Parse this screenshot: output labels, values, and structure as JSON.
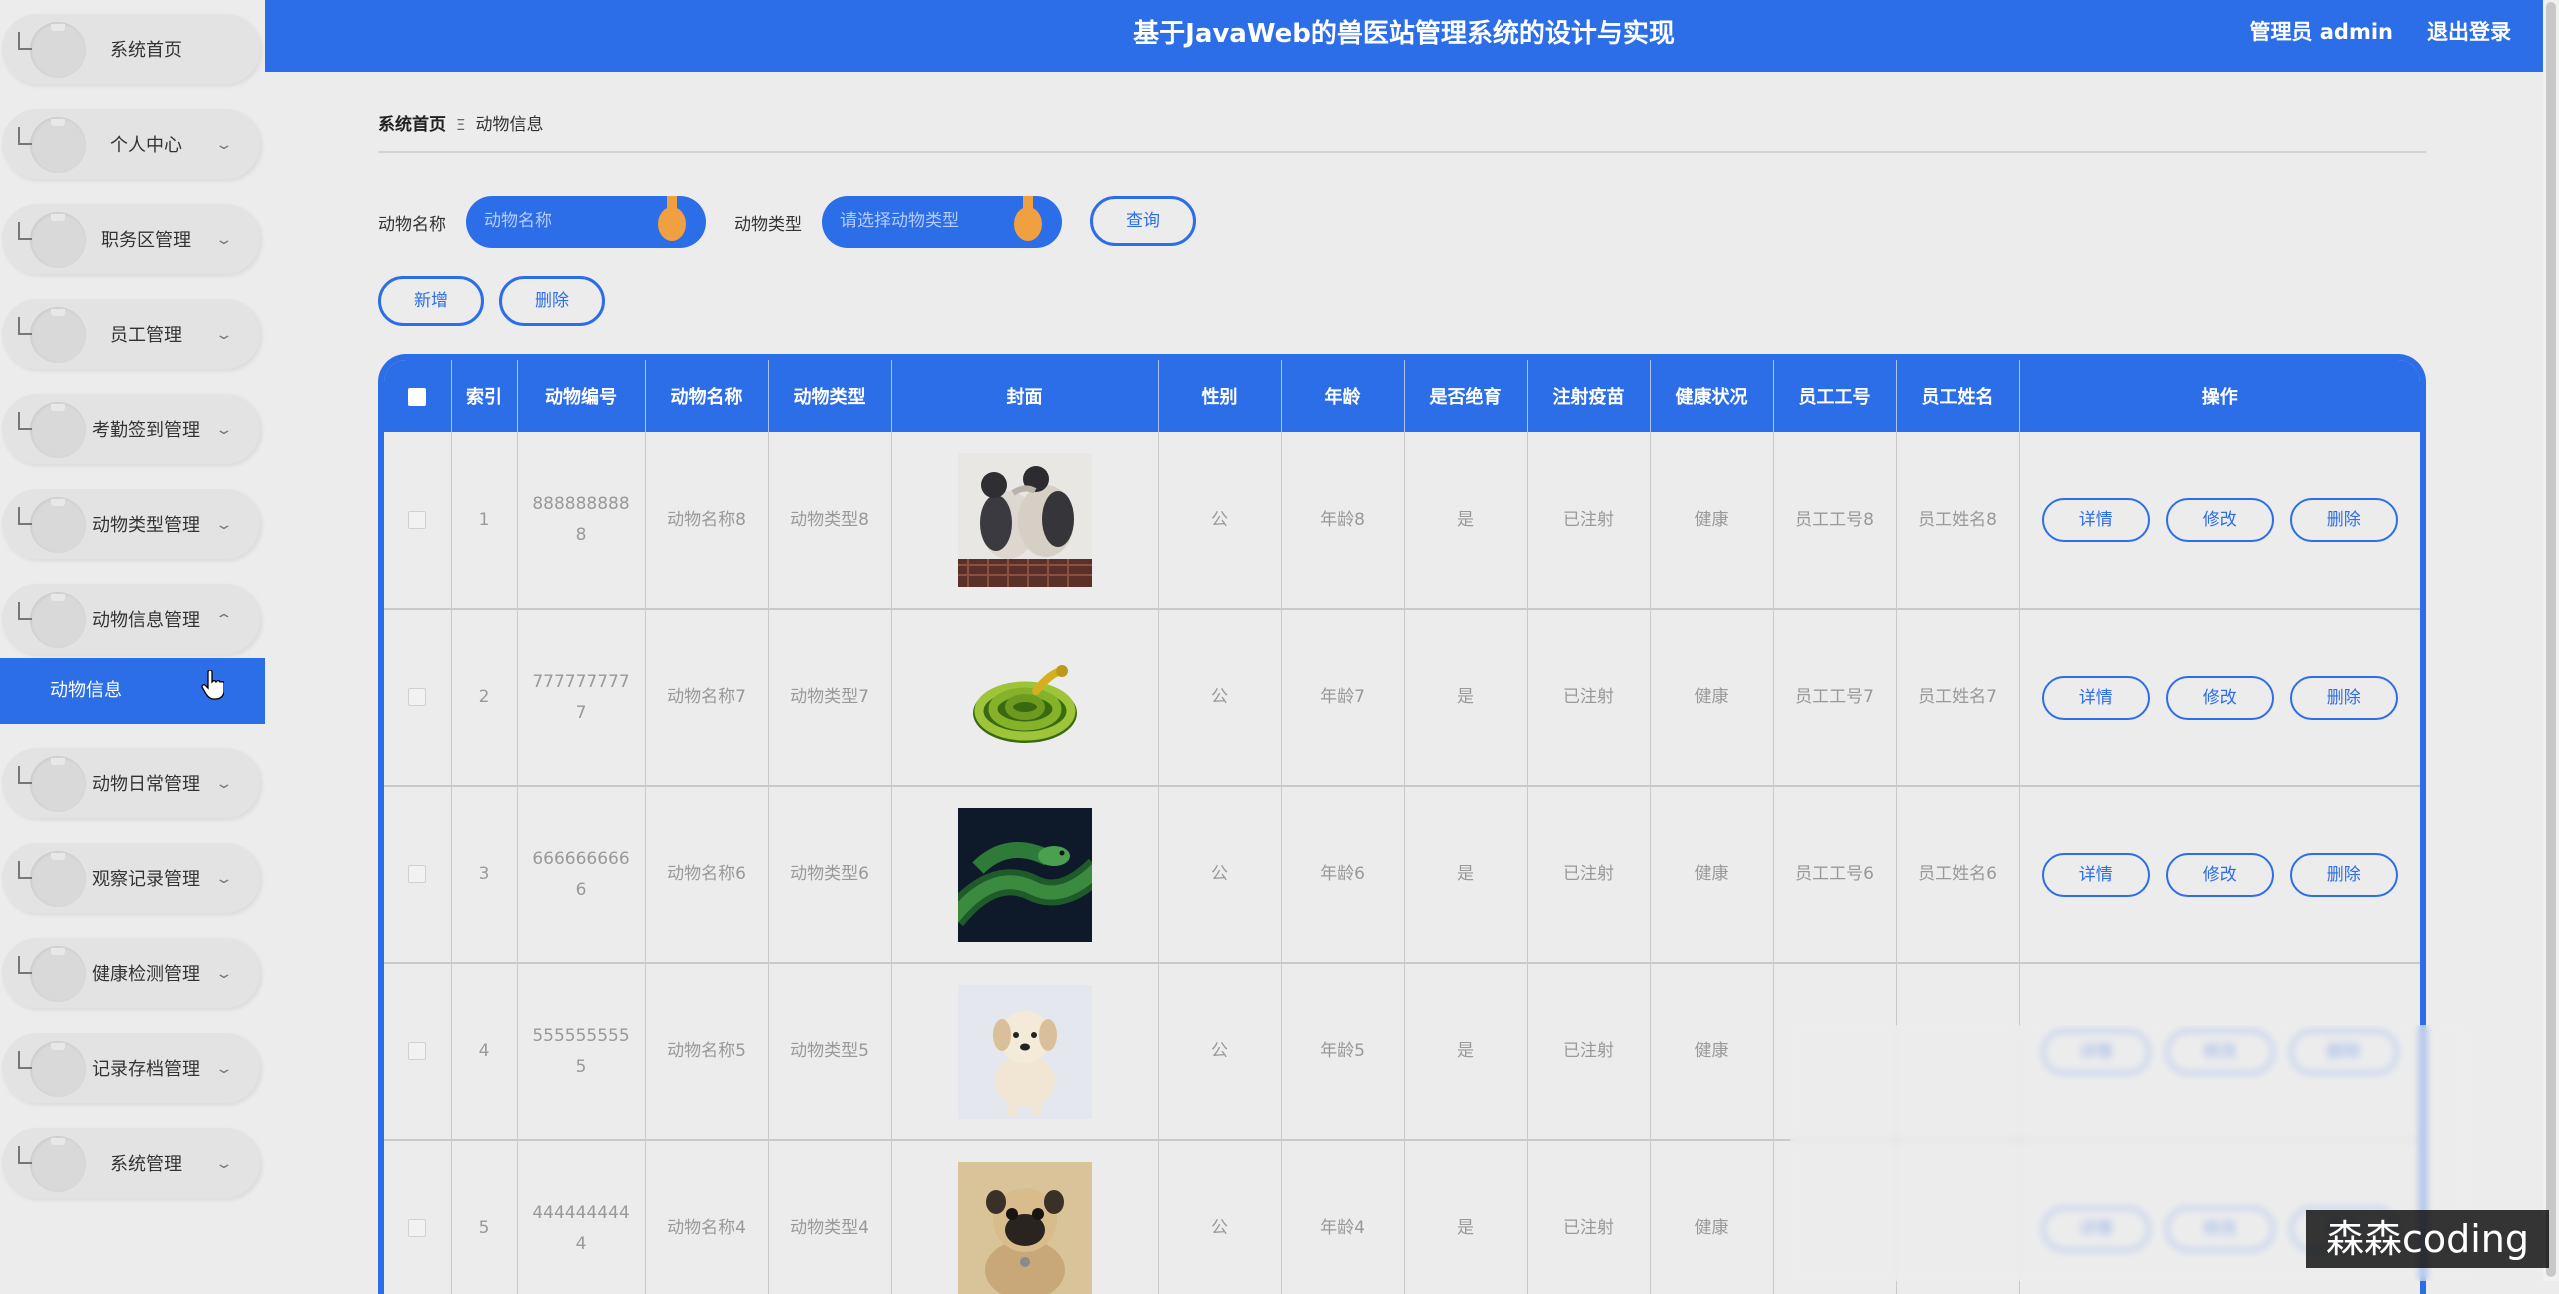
{
  "header": {
    "title": "基于JavaWeb的兽医站管理系统的设计与实现",
    "user": "管理员 admin",
    "logout": "退出登录"
  },
  "sidebar": {
    "items": [
      "系统首页",
      "个人中心",
      "职务区管理",
      "员工管理",
      "考勤签到管理",
      "动物类型管理",
      "动物信息管理",
      "动物日常管理",
      "观察记录管理",
      "健康检测管理",
      "记录存档管理",
      "系统管理"
    ],
    "active_sub": "动物信息"
  },
  "breadcrumb": {
    "home": "系统首页",
    "sep": "Ξ",
    "current": "动物信息"
  },
  "search": {
    "name_label": "动物名称",
    "name_placeholder": "动物名称",
    "type_label": "动物类型",
    "type_placeholder": "请选择动物类型",
    "query": "查询"
  },
  "actions": {
    "add": "新增",
    "delete": "删除"
  },
  "table": {
    "headers": [
      "索引",
      "动物编号",
      "动物名称",
      "动物类型",
      "封面",
      "性别",
      "年龄",
      "是否绝育",
      "注射疫苗",
      "健康状况",
      "员工工号",
      "员工姓名",
      "操作"
    ],
    "row_buttons": {
      "detail": "详情",
      "edit": "修改",
      "delete": "删除"
    },
    "rows": [
      {
        "index": "1",
        "code_a": "888888888",
        "code_b": "8",
        "name": "动物名称8",
        "type": "动物类型8",
        "cover": "birds",
        "gender": "公",
        "age": "年龄8",
        "sterilized": "是",
        "vaccine": "已注射",
        "health": "健康",
        "emp_no": "员工工号8",
        "emp_name": "员工姓名8"
      },
      {
        "index": "2",
        "code_a": "777777777",
        "code_b": "7",
        "name": "动物名称7",
        "type": "动物类型7",
        "cover": "coiled-snake",
        "gender": "公",
        "age": "年龄7",
        "sterilized": "是",
        "vaccine": "已注射",
        "health": "健康",
        "emp_no": "员工工号7",
        "emp_name": "员工姓名7"
      },
      {
        "index": "3",
        "code_a": "666666666",
        "code_b": "6",
        "name": "动物名称6",
        "type": "动物类型6",
        "cover": "green-snake",
        "gender": "公",
        "age": "年龄6",
        "sterilized": "是",
        "vaccine": "已注射",
        "health": "健康",
        "emp_no": "员工工号6",
        "emp_name": "员工姓名6"
      },
      {
        "index": "4",
        "code_a": "555555555",
        "code_b": "5",
        "name": "动物名称5",
        "type": "动物类型5",
        "cover": "puppy",
        "gender": "公",
        "age": "年龄5",
        "sterilized": "是",
        "vaccine": "已注射",
        "health": "健康",
        "emp_no": "",
        "emp_name": ""
      },
      {
        "index": "5",
        "code_a": "444444444",
        "code_b": "4",
        "name": "动物名称4",
        "type": "动物类型4",
        "cover": "pug",
        "gender": "公",
        "age": "年龄4",
        "sterilized": "是",
        "vaccine": "已注射",
        "health": "健康",
        "emp_no": "",
        "emp_name": ""
      }
    ]
  },
  "watermark": "森森coding",
  "colors": {
    "primary": "#2c6de8",
    "background": "#ececec",
    "knob": "#f0a040"
  }
}
